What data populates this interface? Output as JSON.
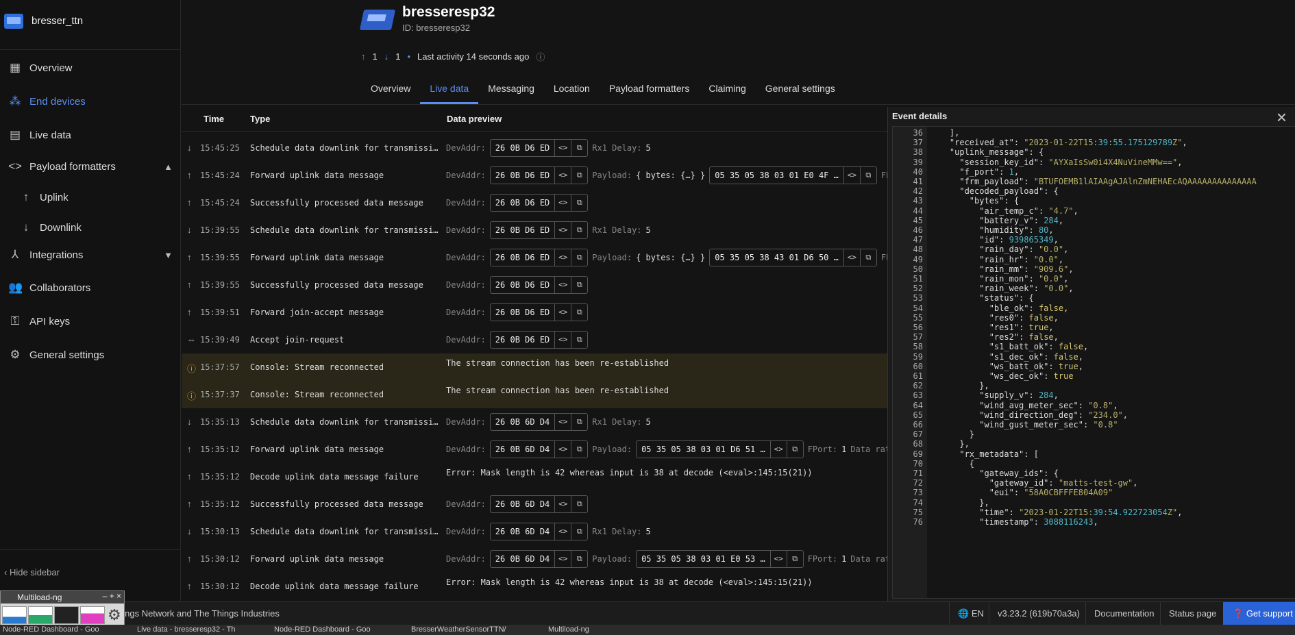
{
  "app": {
    "name": "bresser_ttn"
  },
  "sidebar": {
    "items": [
      {
        "label": "Overview",
        "icon": "overview-icon"
      },
      {
        "label": "End devices",
        "icon": "end-devices-icon"
      },
      {
        "label": "Live data",
        "icon": "live-data-icon"
      },
      {
        "label": "Payload formatters",
        "icon": "code-icon"
      },
      {
        "label": "Uplink",
        "icon": "arrow-up-icon"
      },
      {
        "label": "Downlink",
        "icon": "arrow-down-icon"
      },
      {
        "label": "Integrations",
        "icon": "integrations-icon"
      },
      {
        "label": "Collaborators",
        "icon": "people-icon"
      },
      {
        "label": "API keys",
        "icon": "key-icon"
      },
      {
        "label": "General settings",
        "icon": "gear-icon"
      }
    ],
    "hide_label": "Hide sidebar"
  },
  "device": {
    "name": "bresseresp32",
    "id_label": "ID: bresseresp32",
    "up_count": "1",
    "down_count": "1",
    "last_activity": "Last activity 14 seconds ago"
  },
  "tabs": [
    "Overview",
    "Live data",
    "Messaging",
    "Location",
    "Payload formatters",
    "Claiming",
    "General settings"
  ],
  "table": {
    "headers": {
      "time": "Time",
      "type": "Type",
      "preview": "Data preview"
    },
    "devaddr_label": "DevAddr:",
    "payload_label": "Payload:",
    "rx1_label": "Rx1 Delay:",
    "fport_label": "FPort:",
    "data_rate_label": "Data rat",
    "fp_label": "FP",
    "bytes_text": "{ bytes: {…} }",
    "rows": [
      {
        "dir": "down",
        "time": "15:45:25",
        "type": "Schedule data downlink for transmissi…",
        "devaddr": "26 0B D6 ED",
        "rx1": "5"
      },
      {
        "dir": "up",
        "time": "15:45:24",
        "type": "Forward uplink data message",
        "devaddr": "26 0B D6 ED",
        "payload": "05 35 05 38 03 01 E0 4F …",
        "kind": "uplink1"
      },
      {
        "dir": "up",
        "time": "15:45:24",
        "type": "Successfully processed data message",
        "devaddr": "26 0B D6 ED"
      },
      {
        "dir": "down",
        "time": "15:39:55",
        "type": "Schedule data downlink for transmissi…",
        "devaddr": "26 0B D6 ED",
        "rx1": "5"
      },
      {
        "dir": "up",
        "time": "15:39:55",
        "type": "Forward uplink data message",
        "devaddr": "26 0B D6 ED",
        "payload": "05 35 05 38 43 01 D6 50 …",
        "kind": "uplink1"
      },
      {
        "dir": "up",
        "time": "15:39:55",
        "type": "Successfully processed data message",
        "devaddr": "26 0B D6 ED"
      },
      {
        "dir": "up",
        "time": "15:39:51",
        "type": "Forward join-accept message",
        "devaddr": "26 0B D6 ED"
      },
      {
        "dir": "link",
        "time": "15:39:49",
        "type": "Accept join-request",
        "devaddr": "26 0B D6 ED"
      },
      {
        "dir": "warn",
        "time": "15:37:57",
        "type": "Console: Stream reconnected",
        "text": "The stream connection has been re-established"
      },
      {
        "dir": "warn",
        "time": "15:37:37",
        "type": "Console: Stream reconnected",
        "text": "The stream connection has been re-established"
      },
      {
        "dir": "down",
        "time": "15:35:13",
        "type": "Schedule data downlink for transmissi…",
        "devaddr": "26 0B 6D D4",
        "rx1": "5"
      },
      {
        "dir": "up",
        "time": "15:35:12",
        "type": "Forward uplink data message",
        "devaddr": "26 0B 6D D4",
        "payload": "05 35 05 38 03 01 D6 51 …",
        "fport": "1",
        "kind": "uplink2"
      },
      {
        "dir": "up",
        "time": "15:35:12",
        "type": "Decode uplink data message failure",
        "text": "Error: Mask length is 42 whereas input is 38 at decode (<eval>:145:15(21))"
      },
      {
        "dir": "up",
        "time": "15:35:12",
        "type": "Successfully processed data message",
        "devaddr": "26 0B 6D D4"
      },
      {
        "dir": "down",
        "time": "15:30:13",
        "type": "Schedule data downlink for transmissi…",
        "devaddr": "26 0B 6D D4",
        "rx1": "5"
      },
      {
        "dir": "up",
        "time": "15:30:12",
        "type": "Forward uplink data message",
        "devaddr": "26 0B 6D D4",
        "payload": "05 35 05 38 03 01 E0 53 …",
        "fport": "1",
        "kind": "uplink2"
      },
      {
        "dir": "up",
        "time": "15:30:12",
        "type": "Decode uplink data message failure",
        "text": "Error: Mask length is 42 whereas input is 38 at decode (<eval>:145:15(21))"
      }
    ]
  },
  "details": {
    "title": "Event details",
    "lines": [
      {
        "n": "36",
        "t": "    ],"
      },
      {
        "n": "37",
        "t": "    \"received_at\": \"2023-01-22T15:39:55.175129789Z\","
      },
      {
        "n": "38",
        "t": "    \"uplink_message\": {"
      },
      {
        "n": "39",
        "t": "      \"session_key_id\": \"AYXaIsSw0i4X4NuVineMMw==\","
      },
      {
        "n": "40",
        "t": "      \"f_port\": 1,"
      },
      {
        "n": "41",
        "t": "      \"frm_payload\": \"BTUFOEMB1lAIAAgAJAlnZmNEHAEcAQAAAAAAAAAAAAAA"
      },
      {
        "n": "42",
        "t": "      \"decoded_payload\": {"
      },
      {
        "n": "43",
        "t": "        \"bytes\": {"
      },
      {
        "n": "44",
        "t": "          \"air_temp_c\": \"4.7\","
      },
      {
        "n": "45",
        "t": "          \"battery_v\": 284,"
      },
      {
        "n": "46",
        "t": "          \"humidity\": 80,"
      },
      {
        "n": "47",
        "t": "          \"id\": 939865349,"
      },
      {
        "n": "48",
        "t": "          \"rain_day\": \"0.0\","
      },
      {
        "n": "49",
        "t": "          \"rain_hr\": \"0.0\","
      },
      {
        "n": "50",
        "t": "          \"rain_mm\": \"909.6\","
      },
      {
        "n": "51",
        "t": "          \"rain_mon\": \"0.0\","
      },
      {
        "n": "52",
        "t": "          \"rain_week\": \"0.0\","
      },
      {
        "n": "53",
        "t": "          \"status\": {"
      },
      {
        "n": "54",
        "t": "            \"ble_ok\": false,"
      },
      {
        "n": "55",
        "t": "            \"res0\": false,"
      },
      {
        "n": "56",
        "t": "            \"res1\": true,"
      },
      {
        "n": "57",
        "t": "            \"res2\": false,"
      },
      {
        "n": "58",
        "t": "            \"s1_batt_ok\": false,"
      },
      {
        "n": "59",
        "t": "            \"s1_dec_ok\": false,"
      },
      {
        "n": "60",
        "t": "            \"ws_batt_ok\": true,"
      },
      {
        "n": "61",
        "t": "            \"ws_dec_ok\": true"
      },
      {
        "n": "62",
        "t": "          },"
      },
      {
        "n": "63",
        "t": "          \"supply_v\": 284,"
      },
      {
        "n": "64",
        "t": "          \"wind_avg_meter_sec\": \"0.8\","
      },
      {
        "n": "65",
        "t": "          \"wind_direction_deg\": \"234.0\","
      },
      {
        "n": "66",
        "t": "          \"wind_gust_meter_sec\": \"0.8\""
      },
      {
        "n": "67",
        "t": "        }"
      },
      {
        "n": "68",
        "t": "      },"
      },
      {
        "n": "69",
        "t": "      \"rx_metadata\": ["
      },
      {
        "n": "70",
        "t": "        {"
      },
      {
        "n": "71",
        "t": "          \"gateway_ids\": {"
      },
      {
        "n": "72",
        "t": "            \"gateway_id\": \"matts-test-gw\","
      },
      {
        "n": "73",
        "t": "            \"eui\": \"58A0CBFFFE804A09\""
      },
      {
        "n": "74",
        "t": "          },"
      },
      {
        "n": "75",
        "t": "          \"time\": \"2023-01-22T15:39:54.922723054Z\","
      },
      {
        "n": "76",
        "t": "          \"timestamp\": 3088116243,"
      }
    ]
  },
  "footer": {
    "text": "hings Network and The Things Industries",
    "lang": "EN",
    "version": "v3.23.2 (619b70a3a)",
    "docs": "Documentation",
    "status": "Status page",
    "support": "Get support"
  },
  "multiload": {
    "title": "Multiload-ng"
  },
  "taskbar": [
    "Node-RED Dashboard - Goo",
    "Live data - bresseresp32 - Th",
    "Node-RED Dashboard - Goo",
    "BresserWeatherSensorTTN/",
    "Multiload-ng"
  ]
}
